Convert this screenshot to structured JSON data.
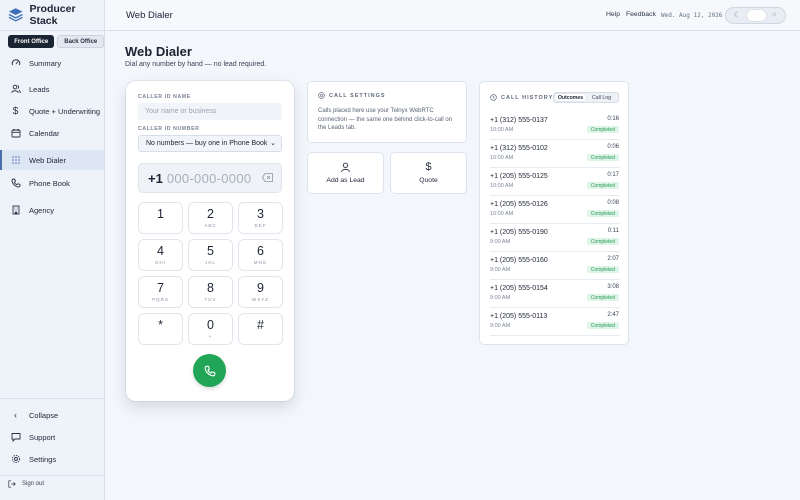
{
  "brand": {
    "name": "Producer Stack"
  },
  "office": {
    "front": "Front Office",
    "back": "Back Office"
  },
  "nav": [
    {
      "label": "Summary",
      "icon": "gauge-icon"
    },
    {
      "label": "Leads",
      "icon": "users-icon"
    },
    {
      "label": "Quote + Underwriting",
      "icon": "dollar-icon"
    },
    {
      "label": "Calendar",
      "icon": "calendar-icon"
    },
    {
      "label": "Web Dialer",
      "icon": "keypad-icon",
      "active": true
    },
    {
      "label": "Phone Book",
      "icon": "phone-icon"
    },
    {
      "label": "Agency",
      "icon": "building-icon"
    }
  ],
  "sidebar_bottom": {
    "collapse": "Collapse",
    "support": "Support",
    "settings": "Settings",
    "signout": "Sign out"
  },
  "topbar": {
    "title": "Web Dialer",
    "help": "Help",
    "feedback": "Feedback",
    "date": "Wed. Aug 12, 2026"
  },
  "page": {
    "title": "Web Dialer",
    "subtitle": "Dial any number by hand — no lead required."
  },
  "dialer": {
    "caller_name_label": "CALLER ID NAME",
    "caller_name_placeholder": "Your name or business",
    "caller_number_label": "CALLER ID NUMBER",
    "caller_number_value": "No numbers — buy one in Phone Book",
    "prefix": "+1",
    "number_placeholder": "000-000-0000",
    "keys": [
      {
        "d": "1",
        "l": ""
      },
      {
        "d": "2",
        "l": "ABC"
      },
      {
        "d": "3",
        "l": "DEF"
      },
      {
        "d": "4",
        "l": "GHI"
      },
      {
        "d": "5",
        "l": "JKL"
      },
      {
        "d": "6",
        "l": "MNO"
      },
      {
        "d": "7",
        "l": "PQRS"
      },
      {
        "d": "8",
        "l": "TUV"
      },
      {
        "d": "9",
        "l": "WXYZ"
      },
      {
        "d": "*",
        "l": ""
      },
      {
        "d": "0",
        "l": "+"
      },
      {
        "d": "#",
        "l": ""
      }
    ]
  },
  "call_settings": {
    "heading": "CALL SETTINGS",
    "body": "Calls placed here use your Telnyx WebRTC connection — the same one behind click-to-call on the Leads tab."
  },
  "actions": {
    "add_lead": "Add as Lead",
    "quote": "Quote"
  },
  "history": {
    "heading": "CALL HISTORY",
    "tabs": [
      "Outcomes",
      "Call Log"
    ],
    "rows": [
      {
        "number": "+1 (312) 555-0137",
        "time": "10:00 AM",
        "duration": "0:16",
        "status": "Completed"
      },
      {
        "number": "+1 (312) 555-0102",
        "time": "10:00 AM",
        "duration": "0:06",
        "status": "Completed"
      },
      {
        "number": "+1 (205) 555-0125",
        "time": "10:00 AM",
        "duration": "0:17",
        "status": "Completed"
      },
      {
        "number": "+1 (205) 555-0126",
        "time": "10:00 AM",
        "duration": "0:08",
        "status": "Completed"
      },
      {
        "number": "+1 (205) 555-0190",
        "time": "9:00 AM",
        "duration": "0:11",
        "status": "Completed"
      },
      {
        "number": "+1 (205) 555-0160",
        "time": "9:00 AM",
        "duration": "2:07",
        "status": "Completed"
      },
      {
        "number": "+1 (205) 555-0154",
        "time": "9:00 AM",
        "duration": "3:08",
        "status": "Completed"
      },
      {
        "number": "+1 (205) 555-0113",
        "time": "9:00 AM",
        "duration": "2:47",
        "status": "Completed"
      }
    ]
  },
  "colors": {
    "accent_dark": "#1b2433",
    "call_green": "#20a656",
    "completed_badge": "#ddf4e6"
  }
}
